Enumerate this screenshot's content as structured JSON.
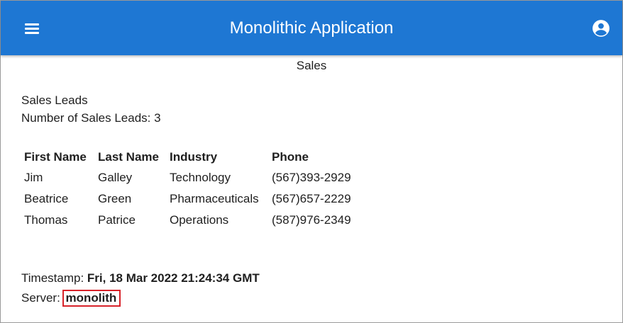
{
  "appbar": {
    "title": "Monolithic Application",
    "menu_icon": "menu-icon",
    "account_icon": "account-circle-icon",
    "color": "#1e77d3"
  },
  "page": {
    "title": "Sales"
  },
  "leads": {
    "heading": "Sales Leads",
    "count_label": "Number of Sales Leads:",
    "count": "3",
    "columns": [
      "First Name",
      "Last Name",
      "Industry",
      "Phone"
    ],
    "rows": [
      [
        "Jim",
        "Galley",
        "Technology",
        "(567)393-2929"
      ],
      [
        "Beatrice",
        "Green",
        "Pharmaceuticals",
        "(567)657-2229"
      ],
      [
        "Thomas",
        "Patrice",
        "Operations",
        "(587)976-2349"
      ]
    ]
  },
  "footer": {
    "timestamp_label": "Timestamp:",
    "timestamp": "Fri, 18 Mar 2022 21:24:34 GMT",
    "server_label": "Server:",
    "server": "monolith",
    "highlight_color": "#d8232a"
  }
}
